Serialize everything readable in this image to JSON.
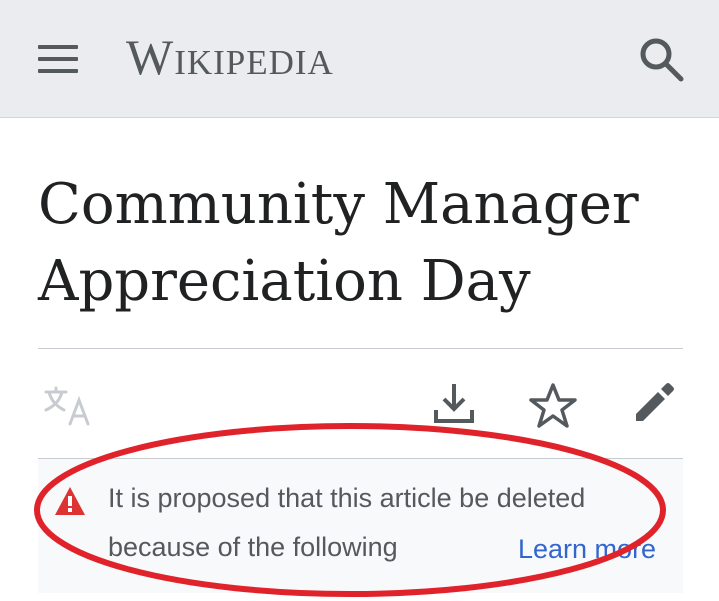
{
  "header": {
    "logo_text": "Wikipedia",
    "menu_icon": "hamburger-menu-icon",
    "search_icon": "search-icon"
  },
  "article": {
    "title_line1": "Community Manager",
    "title_line2": "Appreciation Day"
  },
  "toolbar": {
    "language_icon": "translate-icon",
    "download_icon": "download-icon",
    "watch_icon": "star-icon",
    "edit_icon": "pencil-edit-icon"
  },
  "notice": {
    "line1": "It is proposed that this article be deleted",
    "line2": "because of the following",
    "learn_more": "Learn more",
    "icon": "warning-icon"
  },
  "colors": {
    "header_bg": "#eaecf0",
    "text": "#202122",
    "muted": "#54595d",
    "link": "#3366cc",
    "warning": "#d33",
    "annotation": "#e0232b"
  }
}
